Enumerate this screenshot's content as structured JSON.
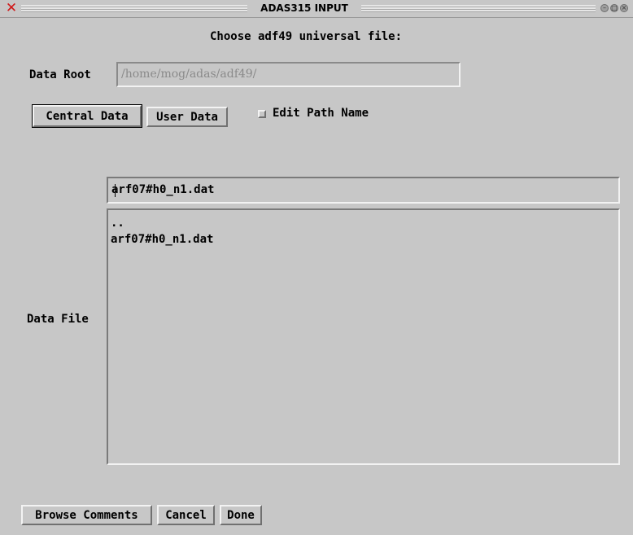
{
  "window": {
    "title": "ADAS315 INPUT",
    "close_icon": "x-close-icon",
    "controls": [
      "minimize-icon",
      "maximize-icon",
      "close-icon"
    ]
  },
  "heading": "Choose adf49 universal file:",
  "data_root": {
    "label": "Data Root",
    "value": "/home/mog/adas/adf49/"
  },
  "source_buttons": {
    "central": "Central Data",
    "user": "User Data"
  },
  "edit_path": {
    "label": "Edit Path Name",
    "checked": false
  },
  "data_file": {
    "label": "Data File",
    "selected_value": "arf07#h0_n1.dat",
    "items": [
      "..",
      "arf07#h0_n1.dat"
    ]
  },
  "footer": {
    "browse": "Browse Comments",
    "cancel": "Cancel",
    "done": "Done"
  }
}
